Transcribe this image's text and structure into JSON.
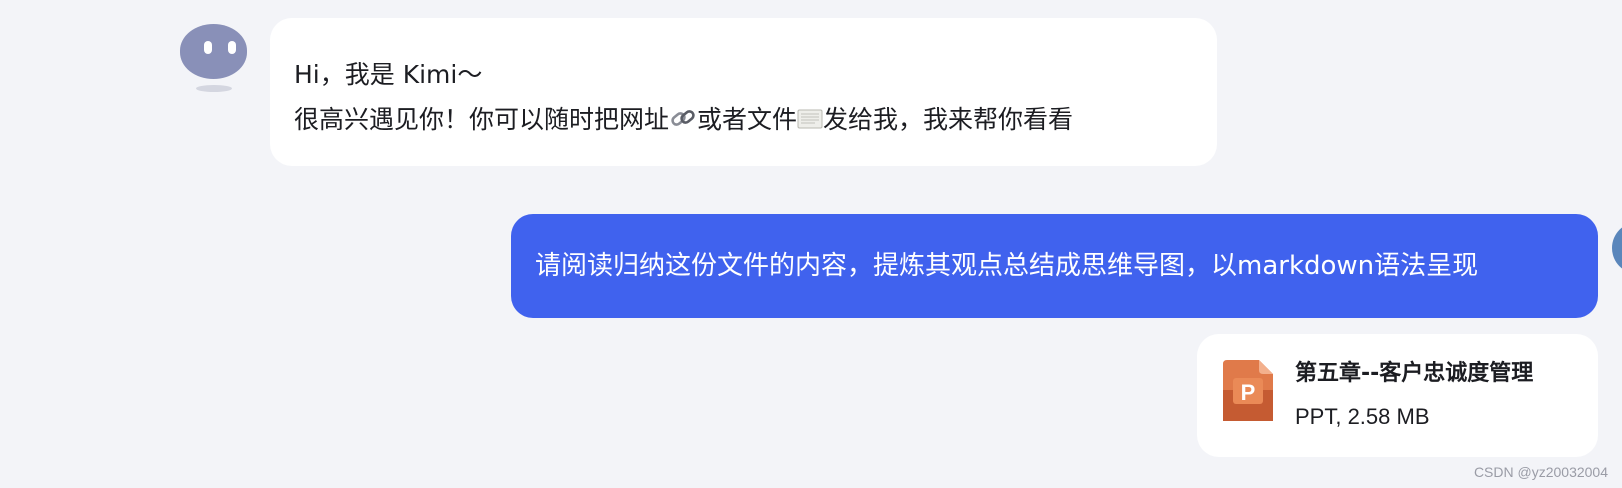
{
  "bot_message": {
    "line1": "Hi，我是 Kimi～",
    "line2_part1": "很高兴遇见你！你可以随时把网址",
    "line2_part2": "或者文件",
    "line2_part3": "发给我，我来帮你看看",
    "link_icon": "link-emoji",
    "file_icon": "page-emoji"
  },
  "user_message": {
    "text": "请阅读归纳这份文件的内容，提炼其观点总结成思维导图，以markdown语法呈现"
  },
  "attachment": {
    "name": "第五章--客户忠诚度管理",
    "meta": "PPT, 2.58 MB",
    "icon_letter": "P",
    "icon_color": "#e07a4a"
  },
  "watermark": "CSDN @yz20032004",
  "colors": {
    "background": "#f3f4f8",
    "user_bubble": "#4062ee",
    "bot_avatar": "#8990b8"
  }
}
